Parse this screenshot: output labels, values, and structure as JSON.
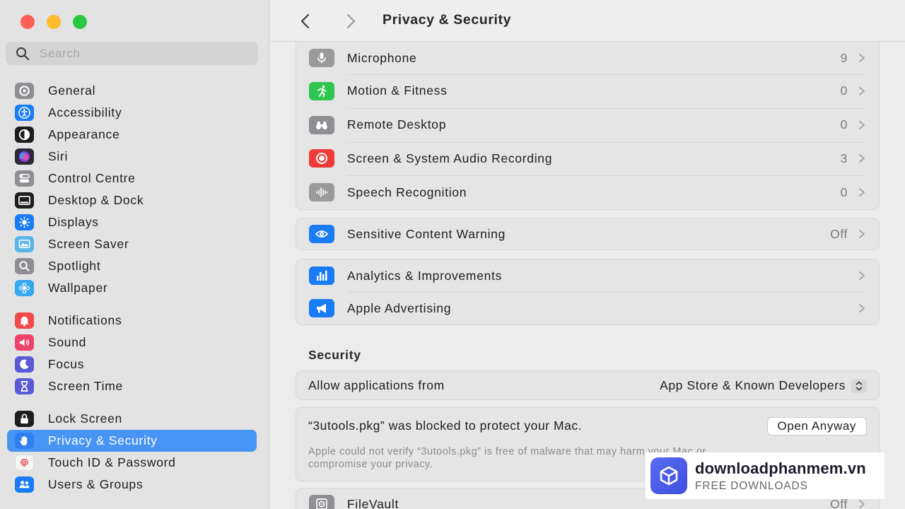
{
  "sidebar": {
    "search_placeholder": "Search",
    "groups": [
      [
        {
          "label": "General",
          "icon": "gear-icon",
          "color": "#8e8e93"
        },
        {
          "label": "Accessibility",
          "icon": "accessibility-icon",
          "color": "#1a7cf5"
        },
        {
          "label": "Appearance",
          "icon": "appearance-icon",
          "color": "#1d1d1f"
        },
        {
          "label": "Siri",
          "icon": "siri-icon",
          "color": "#2a2a3a"
        },
        {
          "label": "Control Centre",
          "icon": "control-centre-icon",
          "color": "#8e8e93"
        },
        {
          "label": "Desktop & Dock",
          "icon": "dock-icon",
          "color": "#1d1d1f"
        },
        {
          "label": "Displays",
          "icon": "brightness-icon",
          "color": "#1a7cf5"
        },
        {
          "label": "Screen Saver",
          "icon": "screen-saver-icon",
          "color": "#5ab6e8"
        },
        {
          "label": "Spotlight",
          "icon": "magnifier-icon",
          "color": "#8e8e93"
        },
        {
          "label": "Wallpaper",
          "icon": "flower-icon",
          "color": "#36a8f0"
        }
      ],
      [
        {
          "label": "Notifications",
          "icon": "bell-icon",
          "color": "#f04a4a"
        },
        {
          "label": "Sound",
          "icon": "speaker-icon",
          "color": "#f0436a"
        },
        {
          "label": "Focus",
          "icon": "moon-icon",
          "color": "#5a5ad6"
        },
        {
          "label": "Screen Time",
          "icon": "hourglass-icon",
          "color": "#5a5ad6"
        }
      ],
      [
        {
          "label": "Lock Screen",
          "icon": "lock-icon",
          "color": "#1d1d1f"
        },
        {
          "label": "Privacy & Security",
          "icon": "hand-icon",
          "color": "#2f7ff0",
          "active": true
        },
        {
          "label": "Touch ID & Password",
          "icon": "fingerprint-icon",
          "color": "#f5f5f5"
        },
        {
          "label": "Users & Groups",
          "icon": "users-icon",
          "color": "#1a7cf5"
        }
      ]
    ]
  },
  "toolbar": {
    "title": "Privacy & Security"
  },
  "privacy_rows": [
    {
      "label": "Microphone",
      "value": "9",
      "icon": "microphone-icon",
      "color": "#9a9a9a"
    },
    {
      "label": "Motion & Fitness",
      "value": "0",
      "icon": "running-figure-icon",
      "color": "#30c551"
    },
    {
      "label": "Remote Desktop",
      "value": "0",
      "icon": "binoculars-icon",
      "color": "#8e8e93"
    },
    {
      "label": "Screen & System Audio Recording",
      "value": "3",
      "icon": "record-icon",
      "color": "#f03a3a"
    },
    {
      "label": "Speech Recognition",
      "value": "0",
      "icon": "waveform-icon",
      "color": "#9a9a9a"
    }
  ],
  "sensitive_row": {
    "label": "Sensitive Content Warning",
    "value": "Off",
    "icon": "eye-warning-icon",
    "color": "#1a7cf5"
  },
  "analytics_rows": [
    {
      "label": "Analytics & Improvements",
      "value": "",
      "icon": "bar-chart-icon",
      "color": "#1a7cf5"
    },
    {
      "label": "Apple Advertising",
      "value": "",
      "icon": "megaphone-icon",
      "color": "#1a7cf5"
    }
  ],
  "security": {
    "title": "Security",
    "allow_label": "Allow applications from",
    "allow_value": "App Store & Known Developers",
    "blocked_text": "“3utools.pkg” was blocked to protect your Mac.",
    "open_anyway": "Open Anyway",
    "blocked_desc_line1": "Apple could not verify “3utools.pkg” is free of malware that may harm your Mac or",
    "blocked_desc_line2": "compromise your privacy.",
    "filevault": {
      "label": "FileVault",
      "value": "Off",
      "icon": "vault-icon",
      "color": "#8e8e93"
    }
  },
  "watermark": {
    "name": "downloadphanmem.vn",
    "tagline": "FREE DOWNLOADS"
  }
}
